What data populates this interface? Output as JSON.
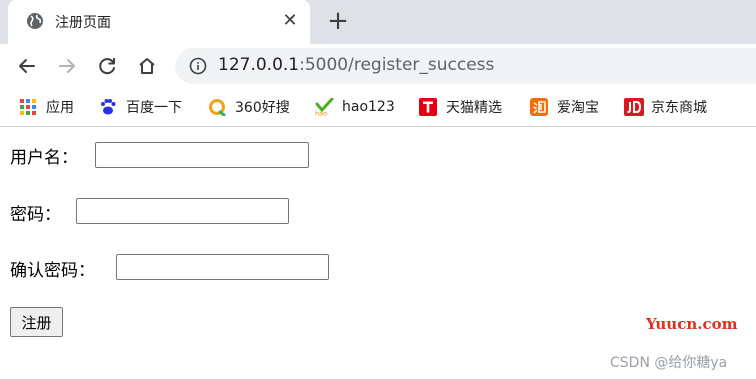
{
  "tab": {
    "title": "注册页面",
    "close_glyph": "✕",
    "new_tab_glyph": "+"
  },
  "address": {
    "host": "127.0.0.1",
    "rest": ":5000/register_success"
  },
  "bookmarks": [
    {
      "label": "应用",
      "icon": "apps-grid-icon"
    },
    {
      "label": "百度一下",
      "icon": "baidu-paw-icon"
    },
    {
      "label": "360好搜",
      "icon": "so360-icon"
    },
    {
      "label": "hao123",
      "icon": "hao123-icon"
    },
    {
      "label": "天猫精选",
      "icon": "tmall-icon"
    },
    {
      "label": "爱淘宝",
      "icon": "taobao-icon"
    },
    {
      "label": "京东商城",
      "icon": "jd-icon"
    }
  ],
  "form": {
    "username_label": "用户名：",
    "username_value": "",
    "password_label": "密码：",
    "password_value": "",
    "confirm_label": "确认密码：",
    "confirm_value": "",
    "submit_label": "注册"
  },
  "watermark": {
    "site": "Yuucn.com",
    "author": "CSDN @给你糖ya"
  }
}
